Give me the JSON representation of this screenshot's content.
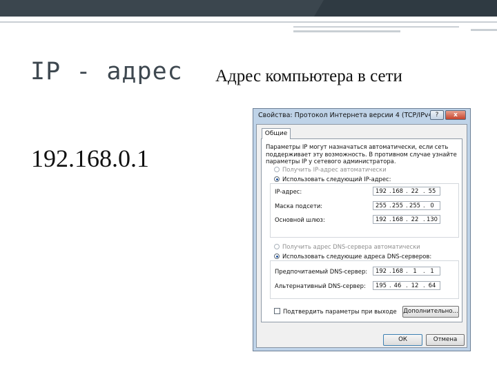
{
  "slide": {
    "title": "IP - адрес",
    "subtitle": "Адрес компьютера в сети",
    "ip_example": "192.168.0.1"
  },
  "dialog": {
    "title": "Свойства: Протокол Интернета версии 4 (TCP/IPv4)",
    "help_label": "?",
    "close_label": "x",
    "tab_general": "Общие",
    "description": "Параметры IP могут назначаться автоматически, если сеть поддерживает эту возможность. В противном случае узнайте параметры IP у сетевого администратора.",
    "ip_auto_label": "Получить IP-адрес автоматически",
    "ip_manual_label": "Использовать следующий IP-адрес:",
    "fields": {
      "ip_label": "IP-адрес:",
      "mask_label": "Маска подсети:",
      "gateway_label": "Основной шлюз:"
    },
    "ip": [
      "192",
      "168",
      "22",
      "55"
    ],
    "mask": [
      "255",
      "255",
      "255",
      "0"
    ],
    "gateway": [
      "192",
      "168",
      "22",
      "130"
    ],
    "dns_auto_label": "Получить адрес DNS-сервера автоматически",
    "dns_manual_label": "Использовать следующие адреса DNS-серверов:",
    "dns_fields": {
      "preferred_label": "Предпочитаемый DNS-сервер:",
      "alternate_label": "Альтернативный DNS-сервер:"
    },
    "dns_preferred": [
      "192",
      "168",
      "1",
      "1"
    ],
    "dns_alternate": [
      "195",
      "46",
      "12",
      "64"
    ],
    "validate_label": "Подтвердить параметры при выходе",
    "advanced_button": "Дополнительно...",
    "ok_button": "ОК",
    "cancel_button": "Отмена"
  },
  "icons": {
    "help": "help-icon",
    "close": "close-icon"
  },
  "colors": {
    "title_bar": "#bfd3e8",
    "close_button": "#c5452f",
    "slide_topbar": "#2f3a42"
  }
}
